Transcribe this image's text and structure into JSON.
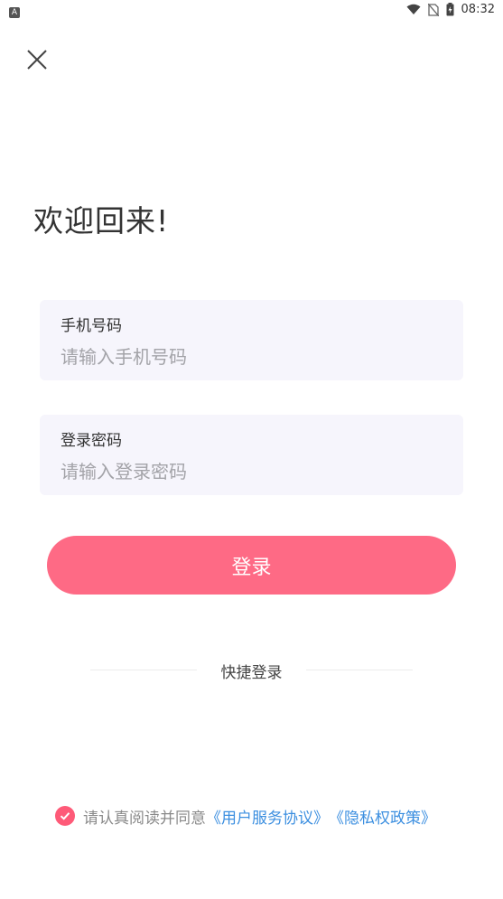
{
  "status_bar": {
    "app_badge": "A",
    "time": "08:32"
  },
  "page": {
    "title": "欢迎回来!"
  },
  "form": {
    "phone": {
      "label": "手机号码",
      "placeholder": "请输入手机号码",
      "value": ""
    },
    "password": {
      "label": "登录密码",
      "placeholder": "请输入登录密码",
      "value": ""
    },
    "login_button": "登录"
  },
  "quick_login": {
    "label": "快捷登录"
  },
  "agreement": {
    "checked": true,
    "prefix": "请认真阅读并同意",
    "user_agreement_link": "《用户服务协议》",
    "privacy_link": "《隐私权政策》"
  },
  "colors": {
    "primary": "#fe6a85",
    "field_bg": "#f6f5fc",
    "link": "#3c8fe0"
  }
}
